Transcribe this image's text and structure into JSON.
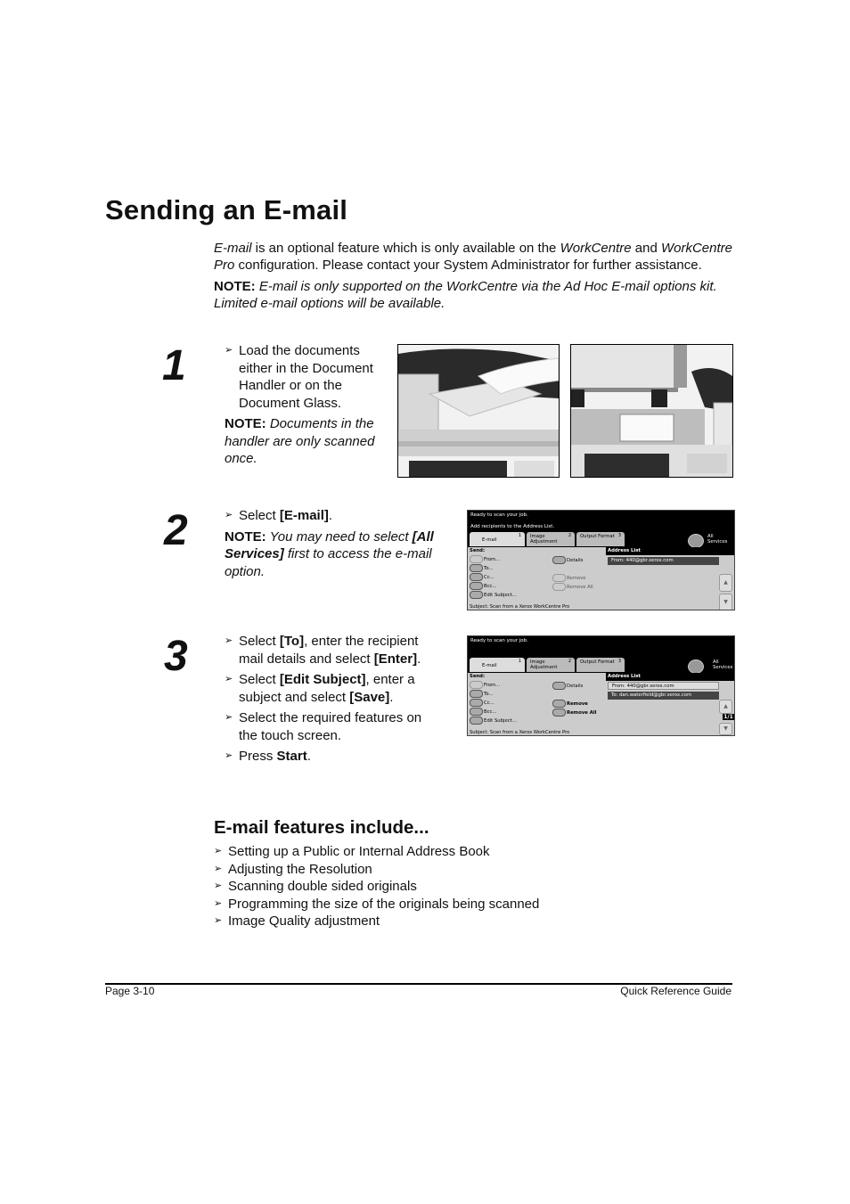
{
  "page_title": "Sending an E-mail",
  "intro": {
    "p1_emph1": "E-mail",
    "p1_t1": " is an optional feature which is only available on the ",
    "p1_emph2": "WorkCentre",
    "p1_t2": " and ",
    "p1_emph3": "WorkCentre Pro",
    "p1_t3": " configuration. Please contact your System Administrator for further assistance.",
    "note_label": "NOTE:",
    "note_text": " E-mail is only supported on the WorkCentre via the Ad Hoc E-mail options kit. Limited e-mail options will be available."
  },
  "bullet_glyph": "➢",
  "steps": [
    {
      "number": "1",
      "bullets": [
        "Load the documents either in the Document Handler or on the Document Glass."
      ],
      "note_label": "NOTE:",
      "note_text": " Documents in the handler are only scanned once.",
      "images": [
        "document-handler-photo",
        "document-glass-photo"
      ]
    },
    {
      "number": "2",
      "bullet_pre": "Select ",
      "bullet_bold": "[E-mail]",
      "bullet_post": ".",
      "note_label": "NOTE:",
      "note_t1": " You may need to select ",
      "note_bold": "[All Services]",
      "note_t2": " first to access the e-mail option."
    },
    {
      "number": "3",
      "b1_pre": "Select ",
      "b1_bold1": "[To]",
      "b1_mid": ", enter the recipient mail details and select ",
      "b1_bold2": "[Enter]",
      "b1_post": ".",
      "b2_pre": "Select ",
      "b2_bold1": "[Edit Subject]",
      "b2_mid": ", enter a subject and select ",
      "b2_bold2": "[Save]",
      "b2_post": ".",
      "b3": "Select the required features on the touch screen.",
      "b4_pre": "Press ",
      "b4_bold": "Start",
      "b4_post": "."
    }
  ],
  "screen1": {
    "status": "Ready to scan your job.",
    "prompt": "Add recipients to the Address List.",
    "tabs": [
      {
        "label": "E-mail",
        "num": "1"
      },
      {
        "label": "Image Adjustment",
        "num": "2"
      },
      {
        "label": "Output Format",
        "num": "3"
      }
    ],
    "all_services": "All Services",
    "send_label": "Send:",
    "buttons": [
      "From...",
      "To...",
      "Cc...",
      "Bcc...",
      "Edit Subject..."
    ],
    "right_buttons": [
      "Details",
      "Remove",
      "Remove All"
    ],
    "subject": "Subject:  Scan from a Xerox WorkCentre Pro",
    "address_list_title": "Address List",
    "addresses": [
      "From: 440@gbr.xerox.com"
    ],
    "scroll_up": "▲",
    "scroll_down": "▼"
  },
  "screen2": {
    "status": "Ready to scan your job.",
    "tabs": [
      {
        "label": "E-mail",
        "num": "1"
      },
      {
        "label": "Image Adjustment",
        "num": "2"
      },
      {
        "label": "Output Format",
        "num": "3"
      }
    ],
    "all_services": "All Services",
    "send_label": "Send:",
    "buttons": [
      "From...",
      "To...",
      "Cc...",
      "Bcc...",
      "Edit Subject..."
    ],
    "right_buttons": [
      "Details",
      "Remove",
      "Remove All"
    ],
    "subject": "Subject:  Scan from a Xerox WorkCentre Pro",
    "address_list_title": "Address List",
    "addresses": [
      "From: 440@gbr.xerox.com",
      "To: dan.waterfield@gbr.xerox.com"
    ],
    "page_indicator": "1/1",
    "scroll_up": "▲",
    "scroll_down": "▼"
  },
  "features": {
    "heading": "E-mail features include...",
    "items": [
      "Setting up a Public or Internal Address Book",
      "Adjusting the Resolution",
      "Scanning double sided originals",
      "Programming the size of the originals being scanned",
      "Image Quality adjustment"
    ]
  },
  "footer": {
    "left": "Page 3-10",
    "right": "Quick Reference Guide"
  }
}
